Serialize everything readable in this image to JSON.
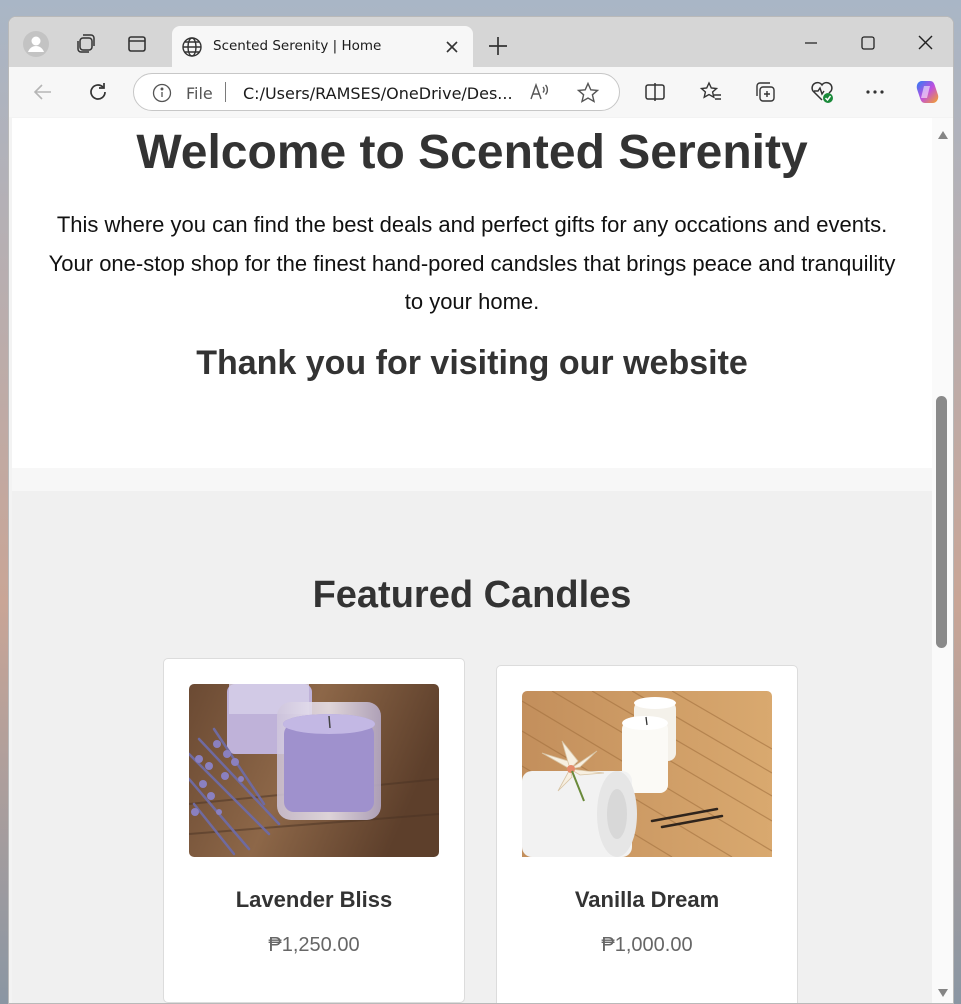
{
  "browser": {
    "tab_title": "Scented Serenity | Home",
    "address_scheme": "File",
    "address_url": "C:/Users/RAMSES/OneDrive/Des..."
  },
  "page": {
    "hero_title": "Welcome to Scented Serenity",
    "hero_text": "This where you can find the best deals and perfect gifts for any occations and events. Your one-stop shop for the finest hand-pored candsles that brings peace and tranquility to your home.",
    "hero_subtitle": "Thank you for visiting our website",
    "featured_title": "Featured Candles",
    "products": [
      {
        "name": "Lavender Bliss",
        "price": "₱1,250.00"
      },
      {
        "name": "Vanilla Dream",
        "price": "₱1,000.00"
      }
    ]
  },
  "icons": [
    "profile-icon",
    "workspaces-icon",
    "vertical-tabs-icon",
    "globe-icon",
    "close-icon",
    "plus-icon",
    "minimize-icon",
    "maximize-icon",
    "back-icon",
    "refresh-icon",
    "info-icon",
    "read-aloud-icon",
    "favorite-star-icon",
    "split-screen-icon",
    "favorites-icon",
    "collections-icon",
    "browser-essentials-icon",
    "more-icon",
    "copilot-icon"
  ]
}
